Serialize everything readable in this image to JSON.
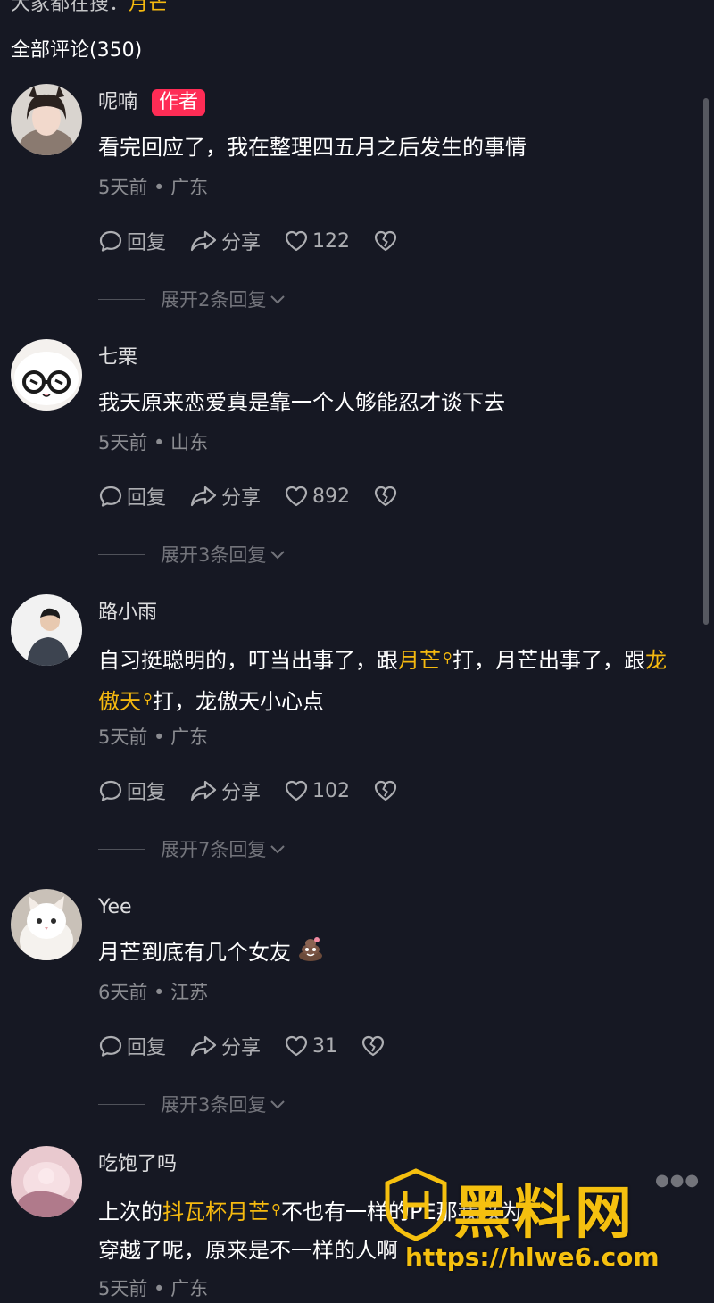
{
  "search_hint": {
    "prefix": "大家都在搜：",
    "keyword": "月芒"
  },
  "comments_header": "全部评论(350)",
  "actions": {
    "reply": "回复",
    "share": "分享"
  },
  "comments": [
    {
      "username": "呢喃",
      "author_tag": "作者",
      "text": "看完回应了，我在整理四五月之后发生的事情",
      "meta": "5天前 • 广东",
      "likes": "122",
      "expand": "展开2条回复"
    },
    {
      "username": "七栗",
      "text": "我天原来恋爱真是靠一个人够能忍才谈下去",
      "meta": "5天前 • 山东",
      "likes": "892",
      "expand": "展开3条回复"
    },
    {
      "username": "路小雨",
      "segments": [
        "自习挺聪明的，叮当出事了，跟",
        "月芒",
        "打，月芒出事了，跟",
        "龙傲天",
        "打，龙傲天小心点"
      ],
      "meta": "5天前 • 广东",
      "likes": "102",
      "expand": "展开7条回复"
    },
    {
      "username": "Yee",
      "text": "月芒到底有几个女友",
      "meta": "6天前 • 江苏",
      "likes": "31",
      "expand": "展开3条回复"
    },
    {
      "username": "吃饱了吗",
      "segments": [
        "上次的",
        "抖瓦杯月芒",
        "不也有一",
        "样的PE",
        "那",
        "我以为",
        "穿越了呢，原来是不一样的人啊"
      ],
      "meta": "5天前 • 广东"
    }
  ],
  "watermark": {
    "name": "黑料网",
    "url": "https://hlwe6.com"
  },
  "colors": {
    "background": "#161823",
    "accent": "#f5b90f",
    "author_tag": "#fe2c55"
  },
  "icons": [
    "comment-bubble-icon",
    "share-arrow-icon",
    "heart-icon",
    "broken-heart-icon",
    "chevron-down-icon",
    "search-lens-icon",
    "poop-emoji-icon",
    "shield-logo-icon"
  ]
}
